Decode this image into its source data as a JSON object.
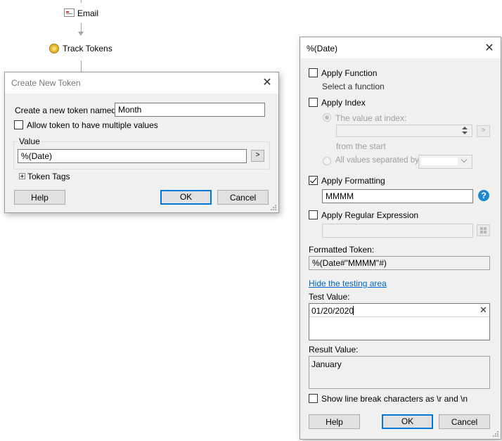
{
  "workflow": {
    "email_label": "Email",
    "track_tokens_label": "Track Tokens"
  },
  "create_token_dialog": {
    "title": "Create New Token",
    "name_label": "Create a new token named:",
    "name_value": "Month",
    "multi_values_label": "Allow token to have multiple values",
    "value_group_label": "Value",
    "value_input": "%(Date)",
    "value_picker_glyph": ">",
    "token_tags_label": "Token Tags",
    "help_label": "Help",
    "ok_label": "OK",
    "cancel_label": "Cancel"
  },
  "date_dialog": {
    "title": "%(Date)",
    "apply_function_label": "Apply Function",
    "select_function_text": "Select a function",
    "apply_index_label": "Apply Index",
    "value_at_index_label": "The value at index:",
    "from_start_text": "from the  start",
    "all_values_separated_label": "All values separated by:",
    "apply_formatting_label": "Apply Formatting",
    "apply_formatting_checked": true,
    "format_value": "MMMM",
    "apply_regex_label": "Apply Regular Expression",
    "formatted_token_label": "Formatted Token:",
    "formatted_token_value": "%(Date#\"MMMM\"#)",
    "hide_testing_link": "Hide the testing area",
    "test_value_label": "Test Value:",
    "test_value": "01/20/2020",
    "result_value_label": "Result Value:",
    "result_value": "January",
    "show_line_break_label": "Show line break characters as \\r and \\n",
    "help_label": "Help",
    "ok_label": "OK",
    "cancel_label": "Cancel",
    "picker_glyph": ">"
  },
  "colors": {
    "dialog_bg": "#f0f0f0",
    "accent": "#0078d7",
    "link": "#0066cc",
    "help_icon": "#1e88d2"
  }
}
